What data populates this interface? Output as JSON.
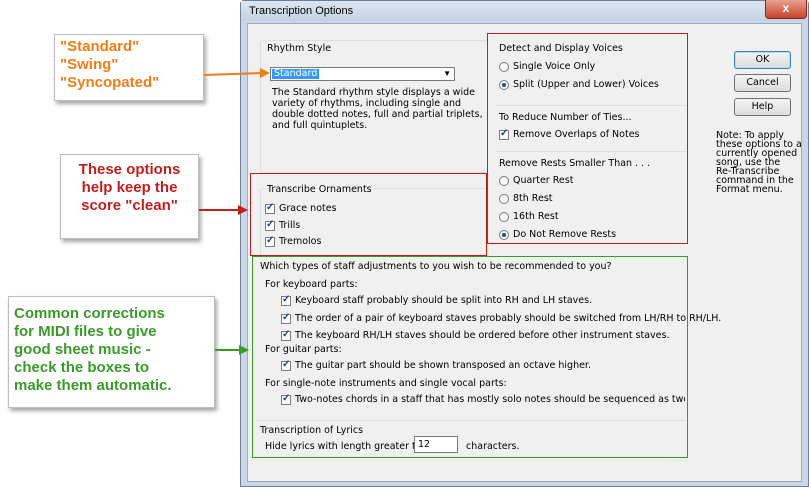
{
  "window": {
    "title": "Transcription Options",
    "close_label": "x"
  },
  "rhythm": {
    "group_title": "Rhythm Style",
    "selected": "Standard",
    "description": [
      "The Standard rhythm style displays a wide",
      "variety of rhythms, including single and",
      "double dotted notes, full and partial triplets,",
      "and full quintuplets."
    ]
  },
  "voices": {
    "group_title": "Detect and Display Voices",
    "options": [
      "Single Voice Only",
      "Split (Upper and Lower) Voices"
    ],
    "selected_index": 1
  },
  "ties": {
    "group_title": "To Reduce Number of Ties...",
    "checkbox": "Remove Overlaps of Notes"
  },
  "rests": {
    "group_title": "Remove Rests Smaller Than . . .",
    "options": [
      "Quarter Rest",
      "8th Rest",
      "16th Rest",
      "Do Not Remove Rests"
    ],
    "selected_index": 3
  },
  "ornaments": {
    "group_title": "Transcribe Ornaments",
    "items": [
      "Grace notes",
      "Trills",
      "Tremolos"
    ]
  },
  "staff": {
    "question": "Which types of staff adjustments to you wish to be recommended to you?",
    "keyboard_label": "For keyboard parts:",
    "keyboard_items": [
      "Keyboard staff probably should be split into RH and LH staves.",
      "The order of a pair of keyboard staves probably should be switched from LH/RH to RH/LH.",
      "The keyboard RH/LH staves should be ordered before other instrument staves."
    ],
    "guitar_label": "For guitar parts:",
    "guitar_item": "The guitar part should be shown transposed an octave higher.",
    "single_label": "For single-note instruments and single vocal parts:",
    "single_item": "Two-notes chords in a staff that has mostly solo notes should be sequenced as two separated note"
  },
  "lyrics": {
    "group_title": "Transcription of Lyrics",
    "label": "Hide lyrics with length greater than:",
    "value": "12",
    "suffix": "characters."
  },
  "buttons": {
    "ok": "OK",
    "cancel": "Cancel",
    "help": "Help"
  },
  "note": [
    "Note: To apply",
    "these options to a",
    "currently opened",
    "song, use the",
    "Re-Transcribe",
    "command in the",
    "Format menu."
  ],
  "callouts": {
    "styles": [
      "\"Standard\"",
      "\"Swing\"",
      "\"Syncopated\""
    ],
    "clean": [
      "These options",
      "help keep the",
      "score \"clean\""
    ],
    "midi": [
      "Common corrections",
      "for MIDI files to give",
      "good sheet music -",
      "check the boxes to",
      "make them automatic."
    ]
  },
  "colors": {
    "orange": "#f07c1a",
    "red": "#c21e1e",
    "green": "#3a9a2a"
  }
}
